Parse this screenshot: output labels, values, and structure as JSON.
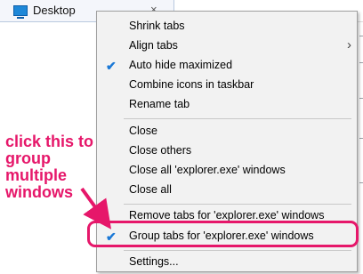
{
  "window": {
    "tab_title": "Desktop",
    "close_glyph": "×"
  },
  "menu": {
    "items": [
      {
        "label": "Shrink tabs",
        "checked": false
      },
      {
        "label": "Align tabs",
        "submenu": true
      },
      {
        "label": "Auto hide maximized",
        "checked": true
      },
      {
        "label": "Combine icons in taskbar",
        "checked": false
      },
      {
        "label": "Rename tab",
        "checked": false
      },
      {
        "label": "Close",
        "checked": false
      },
      {
        "label": "Close others",
        "checked": false
      },
      {
        "label": "Close all 'explorer.exe' windows",
        "checked": false
      },
      {
        "label": "Close all",
        "checked": false
      },
      {
        "label": "Remove tabs for 'explorer.exe' windows",
        "checked": false
      },
      {
        "label": "Group tabs for 'explorer.exe' windows",
        "checked": true
      },
      {
        "label": "Settings...",
        "checked": false
      }
    ],
    "check_glyph": "✔",
    "submenu_glyph": "›"
  },
  "annotation": {
    "text_lines": [
      "click this to",
      "group multiple",
      "windows"
    ],
    "color": "#e6176a"
  }
}
